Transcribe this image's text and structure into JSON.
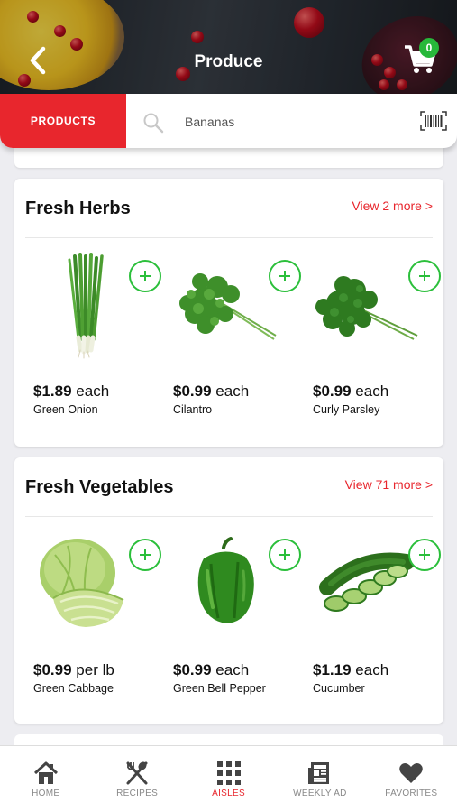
{
  "header": {
    "title": "Produce",
    "cart_count": "0"
  },
  "search": {
    "tab_label": "PRODUCTS",
    "value": "Bananas"
  },
  "sections": [
    {
      "title": "Fresh Herbs",
      "view_more": "View 2 more >",
      "products": [
        {
          "price": "$1.89",
          "unit": "each",
          "name": "Green Onion",
          "icon": "green-onion-image"
        },
        {
          "price": "$0.99",
          "unit": "each",
          "name": "Cilantro",
          "icon": "cilantro-image"
        },
        {
          "price": "$0.99",
          "unit": "each",
          "name": "Curly Parsley",
          "icon": "curly-parsley-image"
        }
      ]
    },
    {
      "title": "Fresh Vegetables",
      "view_more": "View 71 more >",
      "products": [
        {
          "price": "$0.99",
          "unit": "per lb",
          "name": "Green Cabbage",
          "icon": "green-cabbage-image"
        },
        {
          "price": "$0.99",
          "unit": "each",
          "name": "Green Bell Pepper",
          "icon": "green-bell-pepper-image"
        },
        {
          "price": "$1.19",
          "unit": "each",
          "name": "Cucumber",
          "icon": "cucumber-image"
        }
      ]
    }
  ],
  "nav": {
    "items": [
      {
        "label": "HOME",
        "icon": "home-icon"
      },
      {
        "label": "RECIPES",
        "icon": "recipes-icon"
      },
      {
        "label": "AISLES",
        "icon": "aisles-icon",
        "active": true
      },
      {
        "label": "WEEKLY AD",
        "icon": "weekly-ad-icon"
      },
      {
        "label": "FAVORITES",
        "icon": "favorites-icon"
      }
    ]
  },
  "colors": {
    "accent_red": "#e8262d",
    "add_green": "#2bbf3b",
    "badge_green": "#27b83a"
  }
}
